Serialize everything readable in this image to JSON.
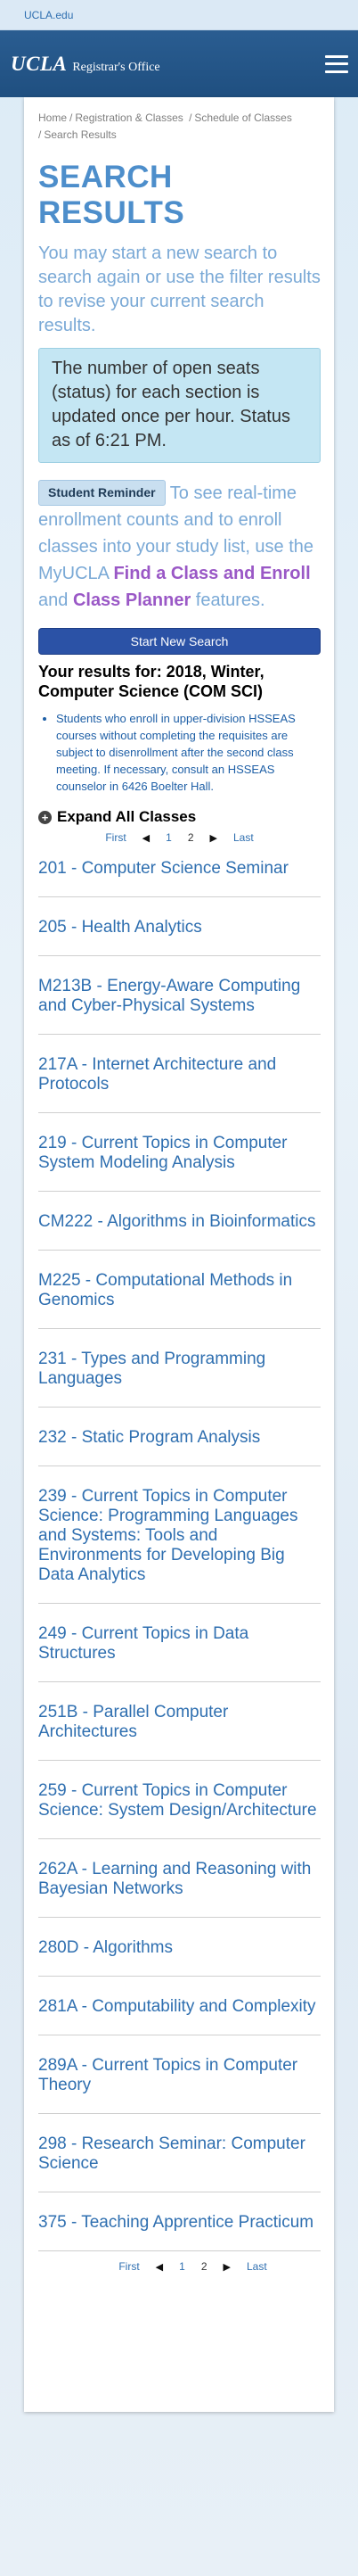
{
  "topbar": {
    "link": "UCLA.edu"
  },
  "header": {
    "logo_ucla": "UCLA",
    "logo_office": "Registrar's Office"
  },
  "breadcrumb": [
    "Home",
    "Registration & Classes",
    "Schedule of Classes",
    "Search Results"
  ],
  "page": {
    "title": "SEARCH RESULTS",
    "intro": "You may start a new search to search again or use the filter results to revise your current search results.",
    "notice": "The number of open seats (status) for each section is updated once per hour. Status as of 6:21 PM.",
    "reminder_badge": "Student Reminder",
    "reminder_text_1": " To see real-time enrollment counts and to enroll classes into your study list, use the MyUCLA ",
    "reminder_link_1": "Find a Class and Enroll",
    "reminder_text_2": " and ",
    "reminder_link_2": "Class Planner",
    "reminder_text_3": " features.",
    "start_button": "Start New Search",
    "results_for": "Your results for: 2018, Winter, Computer Science (COM SCI)",
    "warning": "Students who enroll in upper-division HSSEAS courses without completing the requisites are subject to disenrollment after the second class meeting. If necessary, consult an HSSEAS counselor in 6426 Boelter Hall.",
    "expand_all": "Expand All Classes"
  },
  "pagination": {
    "first": "First",
    "pages": [
      "1",
      "2"
    ],
    "current": "2",
    "last": "Last"
  },
  "courses": [
    "201 - Computer Science Seminar",
    "205 - Health Analytics",
    "M213B - Energy-Aware Computing and Cyber-Physical Systems",
    "217A - Internet Architecture and Protocols",
    "219 - Current Topics in Computer System Modeling Analysis",
    "CM222 - Algorithms in Bioinformatics",
    "M225 - Computational Methods in Genomics",
    "231 - Types and Programming Languages",
    "232 - Static Program Analysis",
    "239 - Current Topics in Computer Science: Programming Languages and Systems: Tools and Environments for Developing Big Data Analytics",
    "249 - Current Topics in Data Structures",
    "251B - Parallel Computer Architectures",
    "259 - Current Topics in Computer Science: System Design/Architecture",
    "262A - Learning and Reasoning with Bayesian Networks",
    "280D - Algorithms",
    "281A - Computability and Complexity",
    "289A - Current Topics in Computer Theory",
    "298 - Research Seminar: Computer Science",
    "375 - Teaching Apprentice Practicum"
  ]
}
